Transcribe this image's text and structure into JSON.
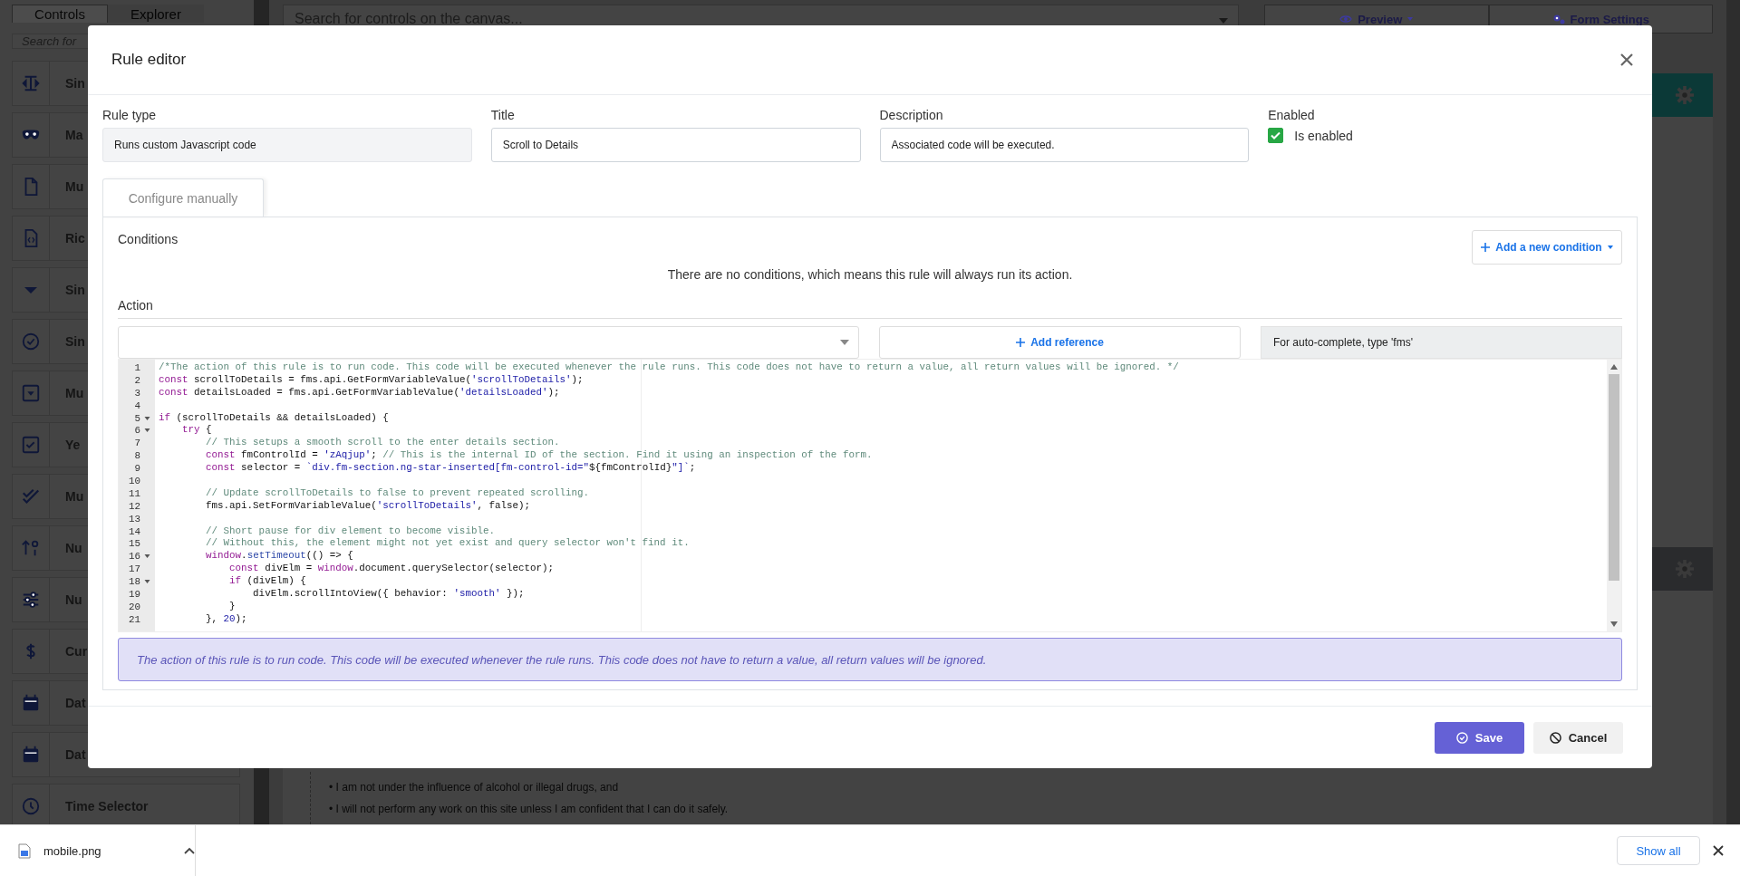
{
  "app": {
    "sidebar_tabs": [
      {
        "label": "Controls",
        "selected": true
      },
      {
        "label": "Explorer",
        "selected": false
      }
    ],
    "sidebar_search": {
      "placeholder": "Search for"
    },
    "controls": [
      {
        "label": "Sin",
        "kind": "text"
      },
      {
        "label": "Ma",
        "kind": "mask"
      },
      {
        "label": "Mu",
        "kind": "file"
      },
      {
        "label": "Ric",
        "kind": "code"
      },
      {
        "label": "Sin",
        "kind": "caret"
      },
      {
        "label": "Sin",
        "kind": "radio"
      },
      {
        "label": "Mu",
        "kind": "select"
      },
      {
        "label": "Ye",
        "kind": "checkbox"
      },
      {
        "label": "Mu",
        "kind": "doublecheck"
      },
      {
        "label": "Nu",
        "kind": "number"
      },
      {
        "label": "Nu",
        "kind": "slider"
      },
      {
        "label": "Cur",
        "kind": "currency"
      },
      {
        "label": "Dat",
        "kind": "calendar"
      },
      {
        "label": "Dat",
        "kind": "calendar"
      },
      {
        "label": "Time Selector",
        "kind": "clock"
      }
    ],
    "canvas_search": {
      "placeholder": "Search for controls on the canvas..."
    },
    "toolbar": [
      {
        "label": "Preview",
        "kind": "preview"
      },
      {
        "label": "Form Settings",
        "kind": "settings"
      }
    ],
    "sections": [
      {
        "color": "#0b3937"
      },
      {
        "color": "#2a2b2d"
      }
    ],
    "bullets": [
      "• I am not under the influence of alcohol or illegal drugs, and",
      "• I will not perform any work on this site unless I am confident that I can do it safely."
    ]
  },
  "rule_editor": {
    "title": "Rule editor",
    "fields": [
      {
        "label": "Rule type",
        "value": "Runs custom Javascript code",
        "readonly": true
      },
      {
        "label": "Title",
        "value": "Scroll to Details",
        "readonly": false
      },
      {
        "label": "Description",
        "value": "Associated code will be executed.",
        "readonly": false
      }
    ],
    "enabled": {
      "label": "Enabled",
      "checkbox_label": "Is enabled",
      "checked": true
    },
    "tabs": [
      {
        "label": "Configure manually",
        "selected": true
      }
    ],
    "conditions": {
      "heading": "Conditions",
      "add_button": "Add a new condition",
      "empty_message": "There are no conditions, which means this rule will always run its action."
    },
    "action": {
      "heading": "Action",
      "add_reference": "Add reference",
      "hint": "For auto-complete, type 'fms'",
      "code_lines": [
        {
          "number": "1",
          "foldable": false,
          "segments": [
            {
              "kind": "comment",
              "text": "/*The action of this rule is to run code. This code will be executed whenever the rule runs. This code does not have to return a value, all return values will be ignored. */"
            }
          ]
        },
        {
          "number": "2",
          "foldable": false,
          "segments": [
            {
              "kind": "keyword",
              "text": "const"
            },
            {
              "kind": "plain",
              "text": " scrollToDetails = fms.api.GetFormVariableValue("
            },
            {
              "kind": "string",
              "text": "'scrollToDetails'"
            },
            {
              "kind": "plain",
              "text": ");"
            }
          ]
        },
        {
          "number": "3",
          "foldable": false,
          "segments": [
            {
              "kind": "keyword",
              "text": "const"
            },
            {
              "kind": "plain",
              "text": " detailsLoaded = fms.api.GetFormVariableValue("
            },
            {
              "kind": "string",
              "text": "'detailsLoaded'"
            },
            {
              "kind": "plain",
              "text": ");"
            }
          ]
        },
        {
          "number": "4",
          "foldable": false
        },
        {
          "number": "5",
          "foldable": true,
          "segments": [
            {
              "kind": "keyword",
              "text": "if"
            },
            {
              "kind": "plain",
              "text": " (scrollToDetails && detailsLoaded) {"
            }
          ]
        },
        {
          "number": "6",
          "foldable": true,
          "segments": [
            {
              "kind": "keyword",
              "text": "    try"
            },
            {
              "kind": "plain",
              "text": " {"
            }
          ]
        },
        {
          "number": "7",
          "foldable": false,
          "segments": [
            {
              "kind": "comment",
              "text": "        // This setups a smooth scroll to the enter details section."
            }
          ]
        },
        {
          "number": "8",
          "foldable": false,
          "segments": [
            {
              "kind": "keyword",
              "text": "        const"
            },
            {
              "kind": "plain",
              "text": " fmControlId = "
            },
            {
              "kind": "string",
              "text": "'zAqjup'"
            },
            {
              "kind": "plain",
              "text": "; "
            },
            {
              "kind": "comment",
              "text": "// This is the internal ID of the section. Find it using an inspection of the form."
            }
          ]
        },
        {
          "number": "9",
          "foldable": false,
          "segments": [
            {
              "kind": "keyword",
              "text": "        const"
            },
            {
              "kind": "plain",
              "text": " selector = "
            },
            {
              "kind": "string",
              "text": "`div.fm-section.ng-star-inserted[fm-control-id=\""
            },
            {
              "kind": "plain",
              "text": "${fmControlId}"
            },
            {
              "kind": "string",
              "text": "\"]`"
            },
            {
              "kind": "plain",
              "text": ";"
            }
          ]
        },
        {
          "number": "10",
          "foldable": false
        },
        {
          "number": "11",
          "foldable": false,
          "segments": [
            {
              "kind": "comment",
              "text": "        // Update scrollToDetails to false to prevent repeated scrolling."
            }
          ]
        },
        {
          "number": "12",
          "foldable": false,
          "segments": [
            {
              "kind": "plain",
              "text": "        fms.api.SetFormVariableValue("
            },
            {
              "kind": "string",
              "text": "'scrollToDetails'"
            },
            {
              "kind": "plain",
              "text": ", false);"
            }
          ]
        },
        {
          "number": "13",
          "foldable": false
        },
        {
          "number": "14",
          "foldable": false,
          "segments": [
            {
              "kind": "comment",
              "text": "        // Short pause for div element to become visible."
            }
          ]
        },
        {
          "number": "15",
          "foldable": false,
          "segments": [
            {
              "kind": "comment",
              "text": "        // Without this, the element might not yet exist and query selector won't find it."
            }
          ]
        },
        {
          "number": "16",
          "foldable": true,
          "segments": [
            {
              "kind": "keyword",
              "text": "        window"
            },
            {
              "kind": "plain",
              "text": "."
            },
            {
              "kind": "builtin",
              "text": "setTimeout"
            },
            {
              "kind": "plain",
              "text": "(() => {"
            }
          ]
        },
        {
          "number": "17",
          "foldable": false,
          "segments": [
            {
              "kind": "keyword",
              "text": "            const"
            },
            {
              "kind": "plain",
              "text": " divElm = "
            },
            {
              "kind": "keyword",
              "text": "window"
            },
            {
              "kind": "plain",
              "text": ".document.querySelector(selector);"
            }
          ]
        },
        {
          "number": "18",
          "foldable": true,
          "segments": [
            {
              "kind": "keyword",
              "text": "            if"
            },
            {
              "kind": "plain",
              "text": " (divElm) {"
            }
          ]
        },
        {
          "number": "19",
          "foldable": false,
          "segments": [
            {
              "kind": "plain",
              "text": "                divElm.scrollIntoView({ behavior: "
            },
            {
              "kind": "string",
              "text": "'smooth'"
            },
            {
              "kind": "plain",
              "text": " });"
            }
          ]
        },
        {
          "number": "20",
          "foldable": false,
          "segments": [
            {
              "kind": "plain",
              "text": "            }"
            }
          ]
        },
        {
          "number": "21",
          "foldable": false,
          "segments": [
            {
              "kind": "plain",
              "text": "        }, "
            },
            {
              "kind": "number",
              "text": "20"
            },
            {
              "kind": "plain",
              "text": ");"
            }
          ]
        }
      ],
      "info": "The action of this rule is to run code. This code will be executed whenever the rule runs. This code does not have to return a value, all return values will be ignored."
    },
    "buttons": [
      {
        "label": "Save",
        "kind": "primary"
      },
      {
        "label": "Cancel",
        "kind": "secondary"
      }
    ]
  },
  "download_bar": {
    "file": "mobile.png",
    "show_all": "Show all"
  }
}
